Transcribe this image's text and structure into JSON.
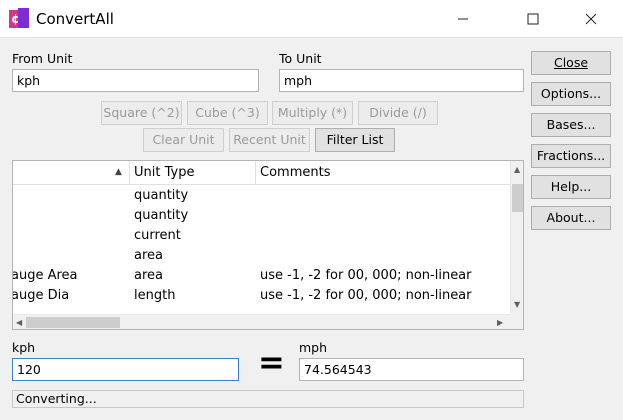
{
  "window": {
    "title": "ConvertAll",
    "minimize_icon": "minimize-icon",
    "maximize_icon": "maximize-icon",
    "close_icon": "close-icon"
  },
  "from_unit": {
    "label": "From Unit",
    "value": "kph"
  },
  "to_unit": {
    "label": "To Unit",
    "value": "mph"
  },
  "operators": [
    {
      "label": "Square (^2)",
      "enabled": false
    },
    {
      "label": "Cube (^3)",
      "enabled": false
    },
    {
      "label": "Multiply (*)",
      "enabled": false
    },
    {
      "label": "Divide (/)",
      "enabled": false
    }
  ],
  "list_buttons": {
    "clear_unit": "Clear Unit",
    "recent_unit": "Recent Unit",
    "filter_list": "Filter List"
  },
  "side_buttons": {
    "close": "Close",
    "options": "Options...",
    "bases": "Bases...",
    "fractions": "Fractions...",
    "help": "Help...",
    "about": "About..."
  },
  "unit_list": {
    "columns": [
      "",
      "Unit Type",
      "Comments"
    ],
    "rows": [
      {
        "name": "",
        "type": "quantity",
        "comment": ""
      },
      {
        "name": "",
        "type": "quantity",
        "comment": ""
      },
      {
        "name": "",
        "type": "current",
        "comment": ""
      },
      {
        "name": "",
        "type": "area",
        "comment": ""
      },
      {
        "name": "auge Area",
        "type": "area",
        "comment": "use -1, -2 for 00, 000; non-linear"
      },
      {
        "name": "auge Dia",
        "type": "length",
        "comment": "use -1, -2 for 00, 000; non-linear"
      }
    ]
  },
  "from_value": {
    "label": "kph",
    "value": "120"
  },
  "equals_sign": "=",
  "to_value": {
    "label": "mph",
    "value": "74.564543"
  },
  "status": "Converting..."
}
